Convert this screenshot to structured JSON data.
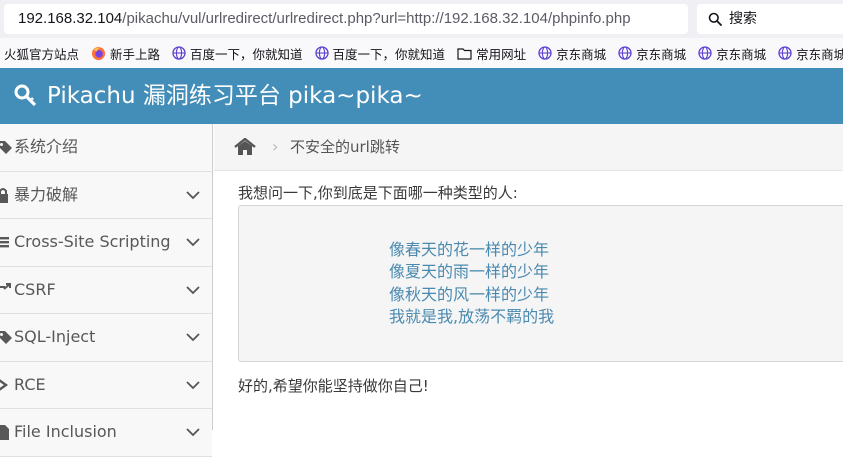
{
  "browser": {
    "url_host": "192.168.32.104",
    "url_path": "/pikachu/vul/urlredirect/urlredirect.php?url=http://192.168.32.104/phpinfo.php",
    "search_placeholder": "搜索"
  },
  "bookmarks": [
    {
      "label": "火狐官方站点",
      "icon": "none"
    },
    {
      "label": "新手上路",
      "icon": "firefox-icon"
    },
    {
      "label": "百度一下，你就知道",
      "icon": "globe-icon"
    },
    {
      "label": "百度一下，你就知道",
      "icon": "globe-icon"
    },
    {
      "label": "常用网址",
      "icon": "folder-icon"
    },
    {
      "label": "京东商城",
      "icon": "globe-icon"
    },
    {
      "label": "京东商城",
      "icon": "globe-icon"
    },
    {
      "label": "京东商城",
      "icon": "globe-icon"
    },
    {
      "label": "京东商城",
      "icon": "globe-icon"
    }
  ],
  "header": {
    "title": "Pikachu 漏洞练习平台 pika~pika~",
    "bg_color": "#438eb9"
  },
  "sidebar": {
    "items": [
      {
        "label": "系统介绍",
        "icon": "tag-icon",
        "has_chevron": false
      },
      {
        "label": "暴力破解",
        "icon": "lock-icon",
        "has_chevron": true
      },
      {
        "label": "Cross-Site Scripting",
        "icon": "lines-icon",
        "has_chevron": true
      },
      {
        "label": "CSRF",
        "icon": "share-icon",
        "has_chevron": true
      },
      {
        "label": "SQL-Inject",
        "icon": "tag-icon",
        "has_chevron": true
      },
      {
        "label": "RCE",
        "icon": "bolt-icon",
        "has_chevron": true
      },
      {
        "label": "File Inclusion",
        "icon": "file-icon",
        "has_chevron": true
      }
    ]
  },
  "breadcrumb": {
    "current": "不安全的url跳转",
    "separator": "›"
  },
  "main": {
    "question": "我想问一下,你到底是下面哪一种类型的人:",
    "options": [
      "像春天的花一样的少年",
      "像夏天的雨一样的少年",
      "像秋天的风一样的少年",
      "我就是我,放荡不羁的我"
    ],
    "answer": "好的,希望你能坚持做你自己!"
  }
}
